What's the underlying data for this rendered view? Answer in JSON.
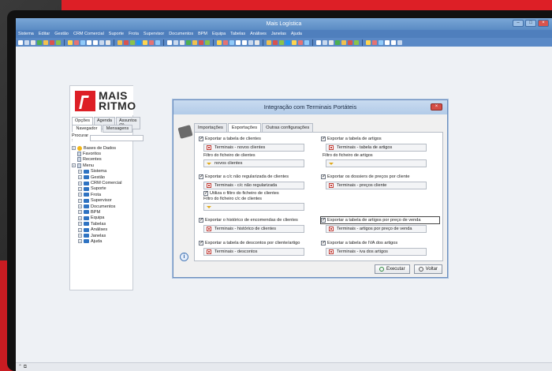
{
  "window": {
    "title": "Mais Logística"
  },
  "menu": [
    "Sistema",
    "Editar",
    "Gestão",
    "CRM Comercial",
    "Suporte",
    "Frota",
    "Supervisor",
    "Documentos",
    "BPM",
    "Equipa",
    "Tabelas",
    "Análises",
    "Janelas",
    "Ajuda"
  ],
  "colors": {
    "brand_red": "#dd1f26",
    "title_blue": "#5a8bc4"
  },
  "logo": {
    "line1": "MAIS",
    "line2": "RITMO"
  },
  "panel": {
    "tabs_top": [
      "Opções",
      "Agenda",
      "Assuntos (0)"
    ],
    "tabs_nav": [
      "Navegador",
      "Mensagens"
    ],
    "search_label": "Procurar :",
    "tree": [
      {
        "label": "Bases de Dados",
        "icon": "database-icon",
        "level": 0
      },
      {
        "label": "Favoritos",
        "icon": "star-icon",
        "level": 0
      },
      {
        "label": "Recentes",
        "icon": "recent-icon",
        "level": 0
      },
      {
        "label": "Menu",
        "icon": "menu-icon",
        "level": 0
      },
      {
        "label": "Sistema",
        "icon": "folder-icon",
        "level": 1
      },
      {
        "label": "Gestão",
        "icon": "folder-icon",
        "level": 1
      },
      {
        "label": "CRM Comercial",
        "icon": "folder-icon",
        "level": 1
      },
      {
        "label": "Suporte",
        "icon": "folder-icon",
        "level": 1
      },
      {
        "label": "Frota",
        "icon": "folder-icon",
        "level": 1
      },
      {
        "label": "Supervisor",
        "icon": "folder-icon",
        "level": 1
      },
      {
        "label": "Documentos",
        "icon": "folder-icon",
        "level": 1
      },
      {
        "label": "BPM",
        "icon": "folder-icon",
        "level": 1
      },
      {
        "label": "Equipa",
        "icon": "folder-icon",
        "level": 1
      },
      {
        "label": "Tabelas",
        "icon": "folder-icon",
        "level": 1
      },
      {
        "label": "Análises",
        "icon": "folder-icon",
        "level": 1
      },
      {
        "label": "Janelas",
        "icon": "folder-icon",
        "level": 1
      },
      {
        "label": "Ajuda",
        "icon": "folder-icon",
        "level": 1
      }
    ]
  },
  "dialog": {
    "title": "Integração com Terminais Portáteis",
    "tabs": [
      "Importações",
      "Exportações",
      "Outras configurações"
    ],
    "left": {
      "s1_check": "Exportar a tabela de clientes",
      "s1_field": "Terminais - novos clientes",
      "s1_filter_label": "Filtro do ficheiro de clientes",
      "s1_filter": "novos clientes",
      "s2_check": "Exportar a c/c não regularizada de clientes",
      "s2_field": "Terminais - c/c não regularizada",
      "s2_sub_check": "Utiliza o filtro do ficheiro de clientes",
      "s2_filter_label": "Filtro do ficheiro c/c de clientes",
      "s3_check": "Exportar o histórico de encomendas de clientes",
      "s3_field": "Terminais - histórico de clientes",
      "s4_check": "Exportar a tabela de descontos por cliente/artigo",
      "s4_field": "Terminais - descontos"
    },
    "right": {
      "s1_check": "Exportar a tabela de artigos",
      "s1_field": "Terminais - tabela de artigos",
      "s1_filter_label": "Filtro do ficheiro de artigos",
      "s2_check": "Exportar os dossiers de preços por cliente",
      "s2_field": "Terminais - preços cliente",
      "s3_check": "Exportar a tabela de artigos por preço de venda",
      "s3_field": "Terminais - artigos por preço de venda",
      "s4_check": "Exportar a tabela de IVA dos artigos",
      "s4_field": "Terminais - iva dos artigos"
    },
    "execute": "Executar",
    "back": "Voltar"
  }
}
